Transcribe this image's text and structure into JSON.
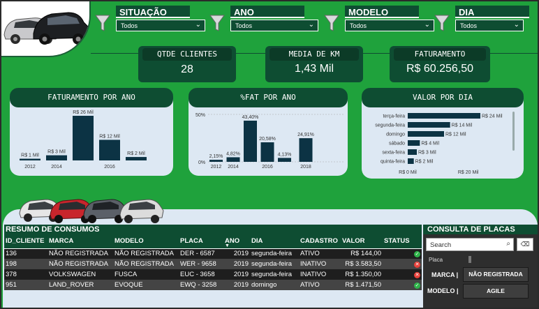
{
  "slicers": [
    {
      "title": "SITUAÇÃO",
      "value": "Todos"
    },
    {
      "title": "ANO",
      "value": "Todos"
    },
    {
      "title": "MODELO",
      "value": "Todos"
    },
    {
      "title": "DIA",
      "value": "Todos"
    }
  ],
  "kpis": {
    "clientes": {
      "title": "QTDE CLIENTES",
      "value": "28"
    },
    "km": {
      "title": "MEDIA DE KM",
      "value": "1,43 Mil"
    },
    "fat": {
      "title": "FATURAMENTO",
      "value": "R$ 60.256,50"
    }
  },
  "icons": {
    "filter": "funnel-icon",
    "cars": "cars-image-icon",
    "status_ok": "check-icon",
    "status_bad": "x-icon",
    "clear": "eraser-icon",
    "search": "search-icon",
    "sort": "sort-desc-icon"
  },
  "colors": {
    "background": "#1fa23c",
    "header": "#0e4d32",
    "bar": "#0c3344",
    "card": "#dde8f3"
  },
  "chart_data": [
    {
      "type": "bar",
      "title": "FATURAMENTO POR ANO",
      "categories": [
        "2012",
        "2014",
        "2015",
        "2016",
        "2018"
      ],
      "x_tick_labels": [
        "2012",
        "2014",
        "2016"
      ],
      "values": [
        1,
        3,
        26,
        12,
        2
      ],
      "data_labels": [
        "R$ 1 Mil",
        "R$ 3 Mil",
        "R$ 26 Mil",
        "R$ 12 Mil",
        "R$ 2 Mil"
      ],
      "ylim": [
        0,
        26
      ]
    },
    {
      "type": "bar",
      "title": "%FAT POR ANO",
      "categories": [
        "2012",
        "2014",
        "2015",
        "2016",
        "2017",
        "2018"
      ],
      "x_tick_labels": [
        "2012",
        "2014",
        "2016",
        "2018"
      ],
      "values": [
        2.15,
        4.82,
        43.4,
        20.58,
        4.13,
        24.91
      ],
      "data_labels": [
        "2,15%",
        "4,82%",
        "43,40%",
        "20,58%",
        "4,13%",
        "24,91%"
      ],
      "y_tick_labels": [
        "50%",
        "0%"
      ],
      "ylim": [
        0,
        50
      ]
    },
    {
      "type": "bar",
      "orientation": "horizontal",
      "title": "VALOR POR DIA",
      "categories": [
        "terça-feira",
        "segunda-feira",
        "domingo",
        "sábado",
        "sexta-feira",
        "quinta-feira"
      ],
      "values": [
        24,
        14,
        12,
        4,
        3,
        2
      ],
      "data_labels": [
        "R$ 24 Mil",
        "R$ 14 Mil",
        "R$ 12 Mil",
        "R$ 4 Mil",
        "R$ 3 Mil",
        "R$ 2 Mil"
      ],
      "x_tick_labels": [
        "R$ 0 Mil",
        "R$ 20 Mil"
      ],
      "xlim": [
        0,
        24
      ]
    }
  ],
  "table": {
    "title": "RESUMO DE CONSUMOS",
    "columns": [
      "ID_CLIENTE",
      "MARCA",
      "MODELO",
      "PLACA",
      "ANO",
      "DIA",
      "CADASTRO",
      "VALOR",
      "STATUS"
    ],
    "rows": [
      {
        "id": "136",
        "marca": "NÃO REGISTRADA",
        "modelo": "NÃO REGISTRADA",
        "placa": "DER - 6587",
        "ano": "2019",
        "dia": "segunda-feira",
        "cadastro": "ATIVO",
        "valor": "R$ 144,00",
        "status": "ok"
      },
      {
        "id": "198",
        "marca": "NÃO REGISTRADA",
        "modelo": "NÃO REGISTRADA",
        "placa": "WER - 9658",
        "ano": "2019",
        "dia": "segunda-feira",
        "cadastro": "INATIVO",
        "valor": "R$ 3.583,50",
        "status": "bad"
      },
      {
        "id": "378",
        "marca": "VOLKSWAGEN",
        "modelo": "FUSCA",
        "placa": "EUC - 3658",
        "ano": "2019",
        "dia": "segunda-feira",
        "cadastro": "INATIVO",
        "valor": "R$ 1.350,00",
        "status": "bad"
      },
      {
        "id": "951",
        "marca": "LAND_ROVER",
        "modelo": "EVOQUE",
        "placa": "EWQ - 3258",
        "ano": "2019",
        "dia": "domingo",
        "cadastro": "ATIVO",
        "valor": "R$ 1.471,50",
        "status": "ok"
      }
    ]
  },
  "consulta": {
    "title": "CONSULTA DE PLACAS",
    "search_placeholder": "Search",
    "placa_label": "Placa",
    "marca_label": "MARCA |",
    "marca_value": "NÃO REGISTRADA",
    "modelo_label": "MODELO |",
    "modelo_value": "AGILE"
  }
}
